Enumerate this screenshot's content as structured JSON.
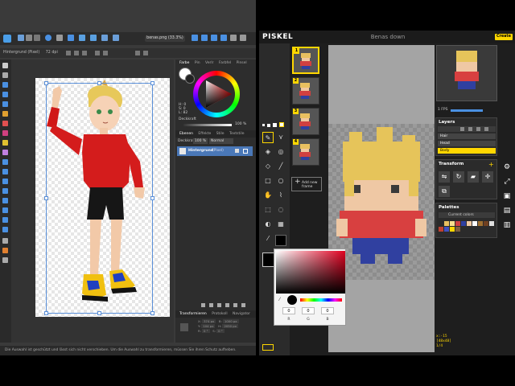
{
  "affinity": {
    "app_icon_label": "A",
    "document_tab": "benas.png (33.3%)",
    "context": {
      "layer_type": "Hintergrund (Pixel)",
      "dpi": "72 dpi"
    },
    "panel_tabs": [
      "Farbe",
      "Pin",
      "Verlr",
      "Farbfel",
      "Pinsel",
      "Str"
    ],
    "color_values": {
      "h": "H: 0",
      "s": "S: 0",
      "l": "L: 82"
    },
    "opacity_label": "Deckkraft",
    "opacity_value": "100 %",
    "layers_tabs": [
      "Ebenen",
      "Effekte",
      "Stile",
      "Textstile"
    ],
    "layers_opacity_label": "Deckkraft:",
    "layers_opacity_value": "100 %",
    "blend_mode": "Normal",
    "layer_name": "Hintergrund",
    "layer_type": "(Pixel)",
    "transform_tabs": [
      "Transformieren",
      "Protokoll",
      "Navigator"
    ],
    "transform_fields": {
      "x": "X:",
      "x_val": "374 px",
      "y": "Y:",
      "y_val": "104 px",
      "w": "B:",
      "w_val": "1000 px",
      "h": "H:",
      "h_val": "2050 px",
      "r": "R:",
      "r_val": "0 °",
      "s": "S:",
      "s_val": "0 °"
    },
    "status_text": "Die Auswahl ist geschützt und lässt sich nicht verschieben. Um die Auswahl zu transformieren, müssen Sie ihren Schutz aufheben."
  },
  "piskel": {
    "logo": "PISKEL",
    "title": "Benas down",
    "create_label": "Create",
    "frames": [
      {
        "num": "1"
      },
      {
        "num": "2"
      },
      {
        "num": "3"
      },
      {
        "num": "4"
      }
    ],
    "add_frame_label": "Add new frame",
    "fps_label": "1 FPS",
    "layers_title": "Layers",
    "layers": [
      {
        "name": "Hair",
        "selected": false
      },
      {
        "name": "Head",
        "selected": false
      },
      {
        "name": "Body",
        "selected": true
      }
    ],
    "transform_title": "Transform",
    "palettes_title": "Palettes",
    "palette_name": "Current colors",
    "palette_colors": [
      "#2a2a2a",
      "#e8c060",
      "#f8e090",
      "#d04040",
      "#3040a0",
      "#f0c8a0",
      "#ffffff",
      "#a07030",
      "#704020",
      "#e0e0e0",
      "#c04030",
      "#4050c0",
      "#ffd700",
      "#806040"
    ],
    "info_lines": [
      "x:-15",
      "[48x48]",
      "1/4"
    ],
    "colorpicker": {
      "r_label": "R",
      "g_label": "G",
      "b_label": "B",
      "r_value": "0",
      "g_value": "0",
      "b_value": "0"
    }
  },
  "colors": {
    "accent_blue": "#4a90e2",
    "piskel_yellow": "#ffd700"
  }
}
